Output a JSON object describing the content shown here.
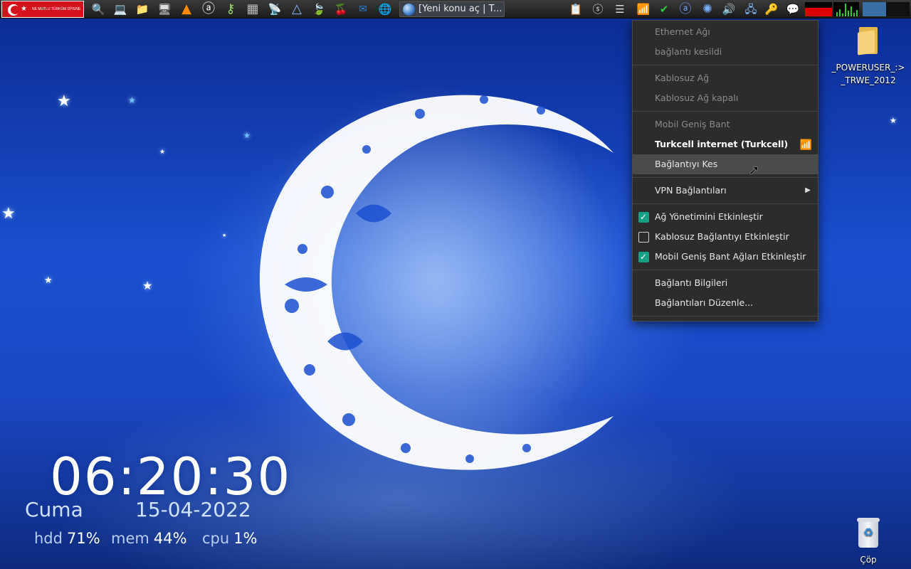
{
  "taskbar": {
    "flag_text": "NE MUTLU TÜRKÜM DİYENE",
    "launchers": [
      {
        "name": "search-icon",
        "glyph": "🔍"
      },
      {
        "name": "computer-icon",
        "glyph": "💻"
      },
      {
        "name": "folder-icon",
        "glyph": "📁"
      },
      {
        "name": "monitor-icon",
        "glyph": "🖥"
      },
      {
        "name": "vlc-icon",
        "glyph": "▲"
      },
      {
        "name": "avast-icon",
        "glyph": "ⓐ"
      },
      {
        "name": "key-tool-icon",
        "glyph": "⚷"
      },
      {
        "name": "calculator-icon",
        "glyph": "▦"
      },
      {
        "name": "satellite-icon",
        "glyph": "📡"
      },
      {
        "name": "inkscape-icon",
        "glyph": "△"
      },
      {
        "name": "leaf-icon",
        "glyph": "🍃"
      },
      {
        "name": "cherry-icon",
        "glyph": "🍒"
      },
      {
        "name": "outlook-icon",
        "glyph": "✉"
      },
      {
        "name": "browser-icon",
        "glyph": "🌐"
      }
    ],
    "active_task": "[Yeni konu aç | T...",
    "tray": [
      {
        "name": "clipboard-icon",
        "glyph": "📋"
      },
      {
        "name": "skype-icon",
        "glyph": "ⓢ"
      },
      {
        "name": "menu-icon",
        "glyph": "☰"
      },
      {
        "name": "network-signal-icon",
        "glyph": "📶"
      },
      {
        "name": "shield-check-icon",
        "glyph": "✔"
      },
      {
        "name": "avast-tray-icon",
        "glyph": "ⓐ"
      },
      {
        "name": "swirl-icon",
        "glyph": "✺"
      },
      {
        "name": "volume-icon",
        "glyph": "🔊"
      },
      {
        "name": "network-drive-icon",
        "glyph": "🖧"
      },
      {
        "name": "key-icon",
        "glyph": "🔑"
      },
      {
        "name": "chat-icon",
        "glyph": "💬"
      }
    ]
  },
  "desktop": {
    "folder_label": "_POWERUSER_:>_TRWE_2012",
    "trash_label": "Çöp"
  },
  "clock": {
    "time": "06:20:30",
    "day": "Cuma",
    "date": "15-04-2022",
    "hdd_label": "hdd",
    "hdd_value": "71%",
    "mem_label": "mem",
    "mem_value": "44%",
    "cpu_label": "cpu",
    "cpu_value": "1%"
  },
  "net_menu": {
    "ethernet_header": "Ethernet Ağı",
    "ethernet_status": "bağlantı kesildi",
    "wireless_header": "Kablosuz Ağ",
    "wireless_status": "Kablosuz Ağ kapalı",
    "mobile_header": "Mobil Geniş Bant",
    "mobile_connection": "Turkcell internet (Turkcell)",
    "disconnect": "Bağlantıyı Kes",
    "vpn": "VPN Bağlantıları",
    "enable_networking": "Ağ Yönetimini Etkinleştir",
    "enable_networking_checked": true,
    "enable_wireless": "Kablosuz Bağlantıyı Etkinleştir",
    "enable_wireless_checked": false,
    "enable_mobile": "Mobil Geniş Bant Ağları Etkinleştir",
    "enable_mobile_checked": true,
    "connection_info": "Bağlantı Bilgileri",
    "edit_connections": "Bağlantıları Düzenle..."
  }
}
